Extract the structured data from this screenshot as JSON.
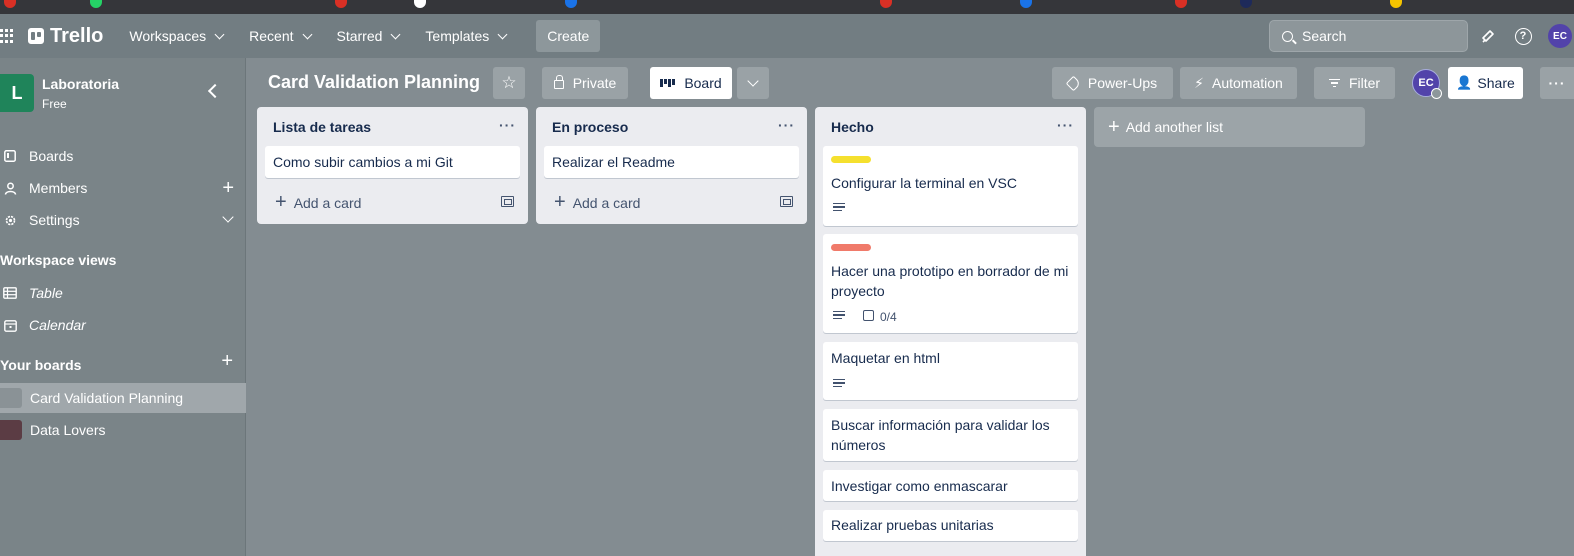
{
  "colors": {
    "topbar": "#727d82",
    "board_bg": "#838c91",
    "sidebar": "#7a8488",
    "workspace_logo": "#1f845a",
    "avatar": "#5243aa",
    "label_yellow": "#f5e02e",
    "label_red": "#f07a6a",
    "list_bg": "#ebecf0"
  },
  "topbar": {
    "logo": "Trello",
    "nav": [
      "Workspaces",
      "Recent",
      "Starred",
      "Templates"
    ],
    "create_label": "Create",
    "search_placeholder": "Search",
    "avatar_initials": "EC",
    "icons": [
      "apps-grid-icon",
      "trello-logo-icon",
      "megaphone-icon",
      "help-icon",
      "search-icon"
    ]
  },
  "sidebar": {
    "workspace_initial": "L",
    "workspace_name": "Laboratoria",
    "workspace_plan": "Free",
    "items": [
      {
        "label": "Boards",
        "icon": "board-icon"
      },
      {
        "label": "Members",
        "icon": "person-icon"
      },
      {
        "label": "Settings",
        "icon": "gear-icon"
      }
    ],
    "views_heading": "Workspace views",
    "views": [
      {
        "label": "Table",
        "icon": "table-icon"
      },
      {
        "label": "Calendar",
        "icon": "calendar-icon"
      }
    ],
    "boards_heading": "Your boards",
    "boards": [
      {
        "label": "Card Validation Planning",
        "active": true,
        "thumb_color": "#8a9296"
      },
      {
        "label": "Data Lovers",
        "active": false,
        "thumb_color": "#5b3c44"
      }
    ]
  },
  "board": {
    "title": "Card Validation Planning",
    "visibility": "Private",
    "view": "Board",
    "powerups": "Power-Ups",
    "automation": "Automation",
    "filter": "Filter",
    "member_initials": "EC",
    "share": "Share"
  },
  "lists": [
    {
      "title": "Lista de tareas",
      "cards": [
        {
          "text": "Como subir cambios a mi Git"
        }
      ],
      "add_label": "Add a card"
    },
    {
      "title": "En proceso",
      "cards": [
        {
          "text": "Realizar el Readme"
        }
      ],
      "add_label": "Add a card"
    },
    {
      "title": "Hecho",
      "cards": [
        {
          "text": "Configurar la terminal en VSC",
          "label_color": "#f5e02e",
          "has_description": true
        },
        {
          "text": "Hacer una prototipo en borrador de mi proyecto",
          "label_color": "#f07a6a",
          "has_description": true,
          "checklist": "0/4"
        },
        {
          "text": "Maquetar en html",
          "has_description": true
        },
        {
          "text": "Buscar información para validar los números"
        },
        {
          "text": "Investigar como enmascarar"
        },
        {
          "text": "Realizar pruebas unitarias"
        }
      ]
    }
  ],
  "add_list_label": "Add another list"
}
